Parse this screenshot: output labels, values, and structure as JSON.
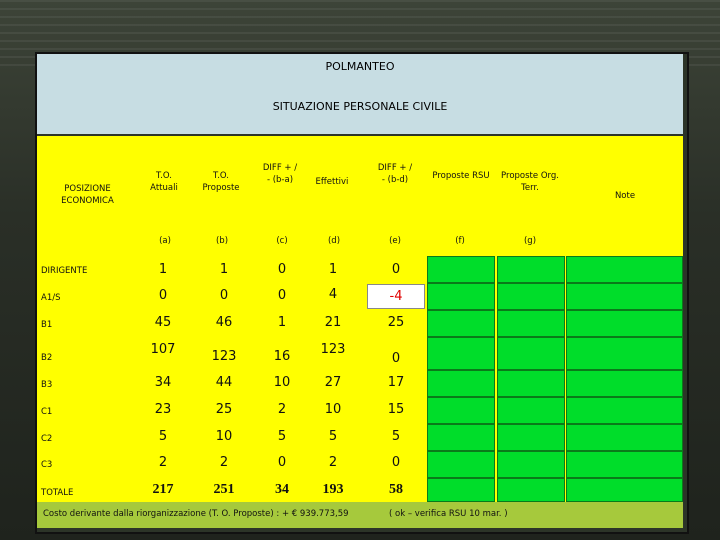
{
  "header": {
    "title": "POLMANTEO",
    "subtitle": "SITUAZIONE PERSONALE CIVILE"
  },
  "columns": [
    {
      "label": "POSIZIONE ECONOMICA",
      "code": ""
    },
    {
      "label": "T.O. Attuali",
      "code": "(a)"
    },
    {
      "label": "T.O. Proposte",
      "code": "(b)"
    },
    {
      "label": "DIFF + / - (b-a)",
      "code": "(c)"
    },
    {
      "label": "Effettivi",
      "code": "(d)"
    },
    {
      "label": "DIFF + / - (b-d)",
      "code": "(e)"
    },
    {
      "label": "Proposte RSU",
      "code": "(f)"
    },
    {
      "label": "Proposte Org. Terr.",
      "code": "(g)"
    },
    {
      "label": "Note",
      "code": ""
    }
  ],
  "rows": [
    {
      "label": "DIRIGENTE",
      "a": "1",
      "b": "1",
      "c": "0",
      "d": "1",
      "e": "0"
    },
    {
      "label": "A1/S",
      "a": "0",
      "b": "0",
      "c": "0",
      "d": "4",
      "e": "-4"
    },
    {
      "label": "B1",
      "a": "45",
      "b": "46",
      "c": "1",
      "d": "21",
      "e": "25"
    },
    {
      "label": "B2",
      "a": "107",
      "b": "123",
      "c": "16",
      "d": "123",
      "e": "0"
    },
    {
      "label": "B3",
      "a": "34",
      "b": "44",
      "c": "10",
      "d": "27",
      "e": "17"
    },
    {
      "label": "C1",
      "a": "23",
      "b": "25",
      "c": "2",
      "d": "10",
      "e": "15"
    },
    {
      "label": "C2",
      "a": "5",
      "b": "10",
      "c": "5",
      "d": "5",
      "e": "5"
    },
    {
      "label": "C3",
      "a": "2",
      "b": "2",
      "c": "0",
      "d": "2",
      "e": "0"
    },
    {
      "label": "TOTALE",
      "a": "217",
      "b": "251",
      "c": "34",
      "d": "193",
      "e": "58"
    }
  ],
  "footer": {
    "cost": "Costo derivante dalla riorganizzazione (T. O. Proposte) : + € 939.773,59",
    "note": "( ok – verifica RSU 10 mar. )"
  },
  "colors": {
    "header_bg": "#c7dde3",
    "table_bg": "#ffff00",
    "cell_green": "#00dd2a",
    "footer_bg": "#a6c93c",
    "negative": "#e00000"
  }
}
